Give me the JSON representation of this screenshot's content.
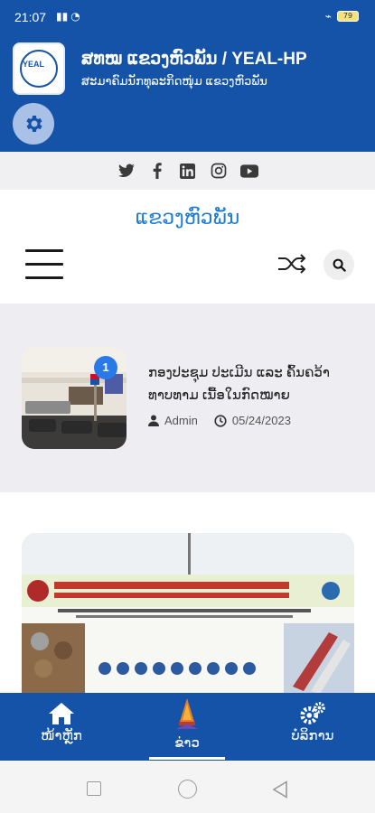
{
  "status_bar": {
    "time": "21:07",
    "battery": "79"
  },
  "header": {
    "title": "ສທໝ ແຂວງຫົວພັນ / YEAL-HP",
    "subtitle": "ສະມາຄົມນັກທຸລະກິດໜຸ່ມ ແຂວງຫົວພັນ",
    "logo_text": "YEAL"
  },
  "colors": {
    "primary": "#1453a8",
    "accent_title": "#1e7cd3",
    "badge": "#2979e8",
    "grey_bg": "#ededf2"
  },
  "social": [
    "twitter-icon",
    "facebook-icon",
    "linkedin-icon",
    "instagram-icon",
    "youtube-icon"
  ],
  "site_title": "ແຂວງຫົວພັນ",
  "news": [
    {
      "title": "ກອງປະຊຸມ ປະເມີນ ແລະ ຄົ້ນຄວ້າທາບທາມ ເນື້ອໃນກົດໝາຍ",
      "author": "Admin",
      "date": "05/24/2023",
      "badge": "1"
    }
  ],
  "bottom_nav": {
    "home": "ໜ້າຫຼັກ",
    "news": "ຂ່າວ",
    "services": "ບໍລິການ"
  }
}
